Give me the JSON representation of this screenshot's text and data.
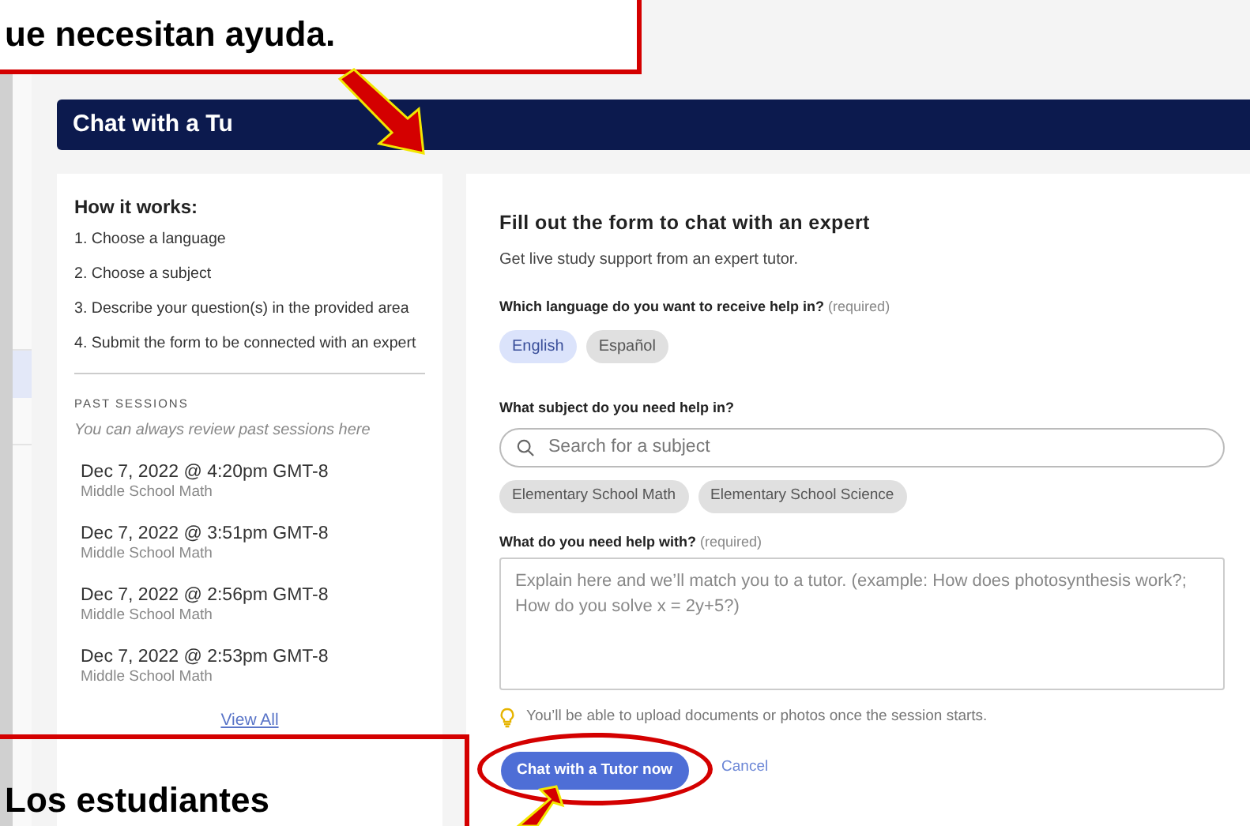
{
  "annotations": [
    {
      "text": "ue necesitan ayuda."
    },
    {
      "text": "Los estudiantes"
    }
  ],
  "header": {
    "title": "Chat with a Tu"
  },
  "how_it_works": {
    "title": "How it works:",
    "steps": [
      "1. Choose a language",
      "2. Choose a subject",
      "3. Describe your question(s) in the provided area",
      "4. Submit the form to be connected with an expert"
    ]
  },
  "past_sessions": {
    "title": "PAST SESSIONS",
    "subtitle": "You can always review past sessions here",
    "sessions": [
      {
        "date": "Dec 7, 2022 @ 4:20pm GMT-8",
        "subject": "Middle School Math"
      },
      {
        "date": "Dec 7, 2022 @ 3:51pm GMT-8",
        "subject": "Middle School Math"
      },
      {
        "date": "Dec 7, 2022 @ 2:56pm GMT-8",
        "subject": "Middle School Math"
      },
      {
        "date": "Dec 7, 2022 @ 2:53pm GMT-8",
        "subject": "Middle School Math"
      }
    ],
    "view_all": "View All"
  },
  "form": {
    "title": "Fill out the form to chat with an expert",
    "subtitle": "Get live study support from an expert tutor.",
    "language_label": "Which language do you want to receive help in?",
    "language_required": "(required)",
    "languages": [
      {
        "label": "English",
        "selected": true
      },
      {
        "label": "Español",
        "selected": false
      }
    ],
    "subject_label": "What subject do you need help in?",
    "subject_search": {
      "placeholder": "Search for a subject"
    },
    "subjects": [
      "Elementary School Math",
      "Elementary School Science"
    ],
    "help_label": "What do you need help with?",
    "help_required": "(required)",
    "help_field": {
      "placeholder": "Explain here and we’ll match you to a tutor. (example: How does photosynthesis work?; How do you solve x = 2y+5?)"
    },
    "tip": "You’ll be able to upload documents or photos once the session starts.",
    "submit": "Chat with a Tutor now",
    "cancel": "Cancel"
  }
}
